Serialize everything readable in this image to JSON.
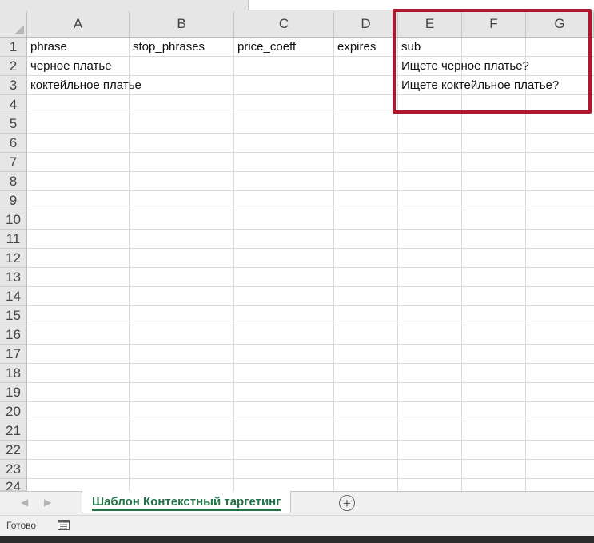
{
  "sheet": {
    "columns": [
      "A",
      "B",
      "C",
      "D",
      "E",
      "F",
      "G"
    ],
    "rows": [
      "1",
      "2",
      "3",
      "4",
      "5",
      "6",
      "7",
      "8",
      "9",
      "10",
      "11",
      "12",
      "13",
      "14",
      "15",
      "16",
      "17",
      "18",
      "19",
      "20",
      "21",
      "22",
      "23",
      "24"
    ],
    "cells": {
      "A1": "phrase",
      "B1": "stop_phrases",
      "C1": "price_coeff",
      "D1": "expires",
      "E1": "sub",
      "A2": "черное платье",
      "E2": "Ищете черное платье?",
      "A3": "коктейльное платье",
      "E3": "Ищете коктейльное платье?"
    }
  },
  "tabs": {
    "active_label": "Шаблон Контекстный таргетинг",
    "prev_icon": "left-arrow-icon",
    "next_icon": "right-arrow-icon",
    "add_icon": "plus-circle-icon"
  },
  "status": {
    "ready_text": "Готово",
    "macro_icon": "macro-record-icon"
  },
  "colors": {
    "highlight": "#b0162c",
    "tab_text": "#217346"
  }
}
